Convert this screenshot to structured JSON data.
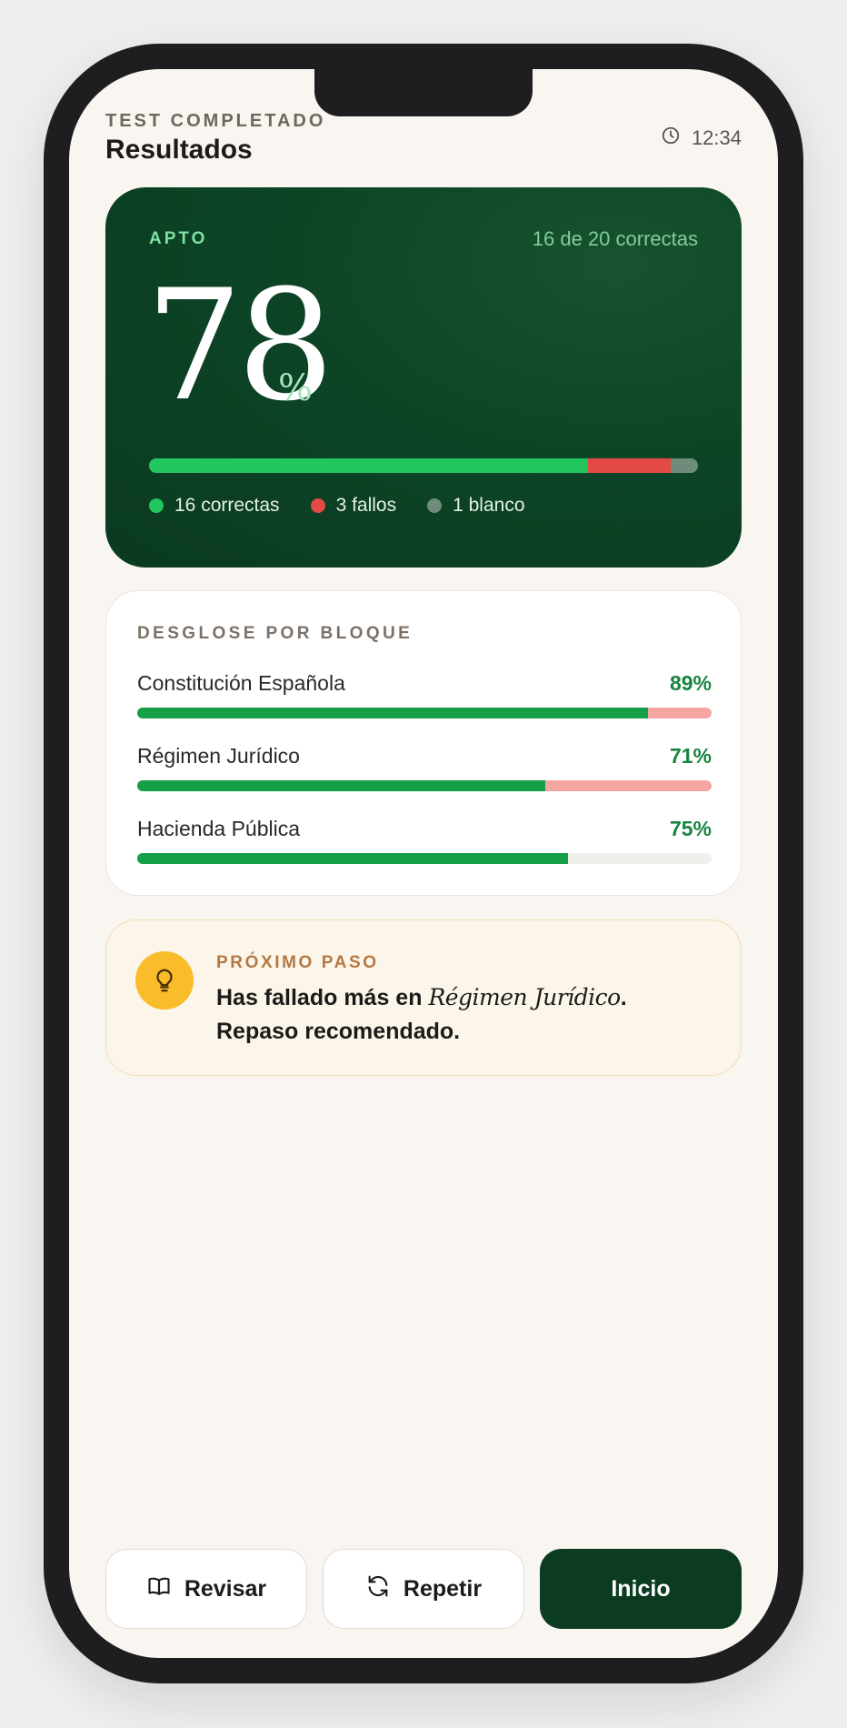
{
  "header": {
    "eyebrow": "TEST COMPLETADO",
    "title": "Resultados",
    "timer": "12:34"
  },
  "score": {
    "status": "APTO",
    "correct_summary": "16 de 20 correctas",
    "value": "78",
    "percent_sign": "%",
    "bar": {
      "correct": 16,
      "fails": 3,
      "blank": 1
    },
    "legend": [
      {
        "label": "16 correctas",
        "color": "#22c55e"
      },
      {
        "label": "3 fallos",
        "color": "#e24a43"
      },
      {
        "label": "1 blanco",
        "color": "#6f8b7b"
      }
    ]
  },
  "breakdown": {
    "title": "DESGLOSE POR BLOQUE",
    "items": [
      {
        "label": "Constitución Española",
        "pct_label": "89%",
        "pct": 89,
        "rest_color": "#f6a6a1"
      },
      {
        "label": "Régimen Jurídico",
        "pct_label": "71%",
        "pct": 71,
        "rest_color": "#f6a6a1"
      },
      {
        "label": "Hacienda Pública",
        "pct_label": "75%",
        "pct": 75,
        "rest_color": "#f1efeb"
      }
    ]
  },
  "next_step": {
    "label": "PRÓXIMO PASO",
    "text_before": "Has fallado más en ",
    "text_topic": "Régimen Jurídico",
    "text_after": ". Repaso recomendado.",
    "icon": "lightbulb-icon"
  },
  "actions": {
    "review": {
      "label": "Revisar",
      "icon": "book-icon"
    },
    "repeat": {
      "label": "Repetir",
      "icon": "refresh-icon"
    },
    "home": {
      "label": "Inicio"
    }
  },
  "colors": {
    "accent_dark": "#0b3b21",
    "success": "#22c55e",
    "error": "#e24a43"
  }
}
